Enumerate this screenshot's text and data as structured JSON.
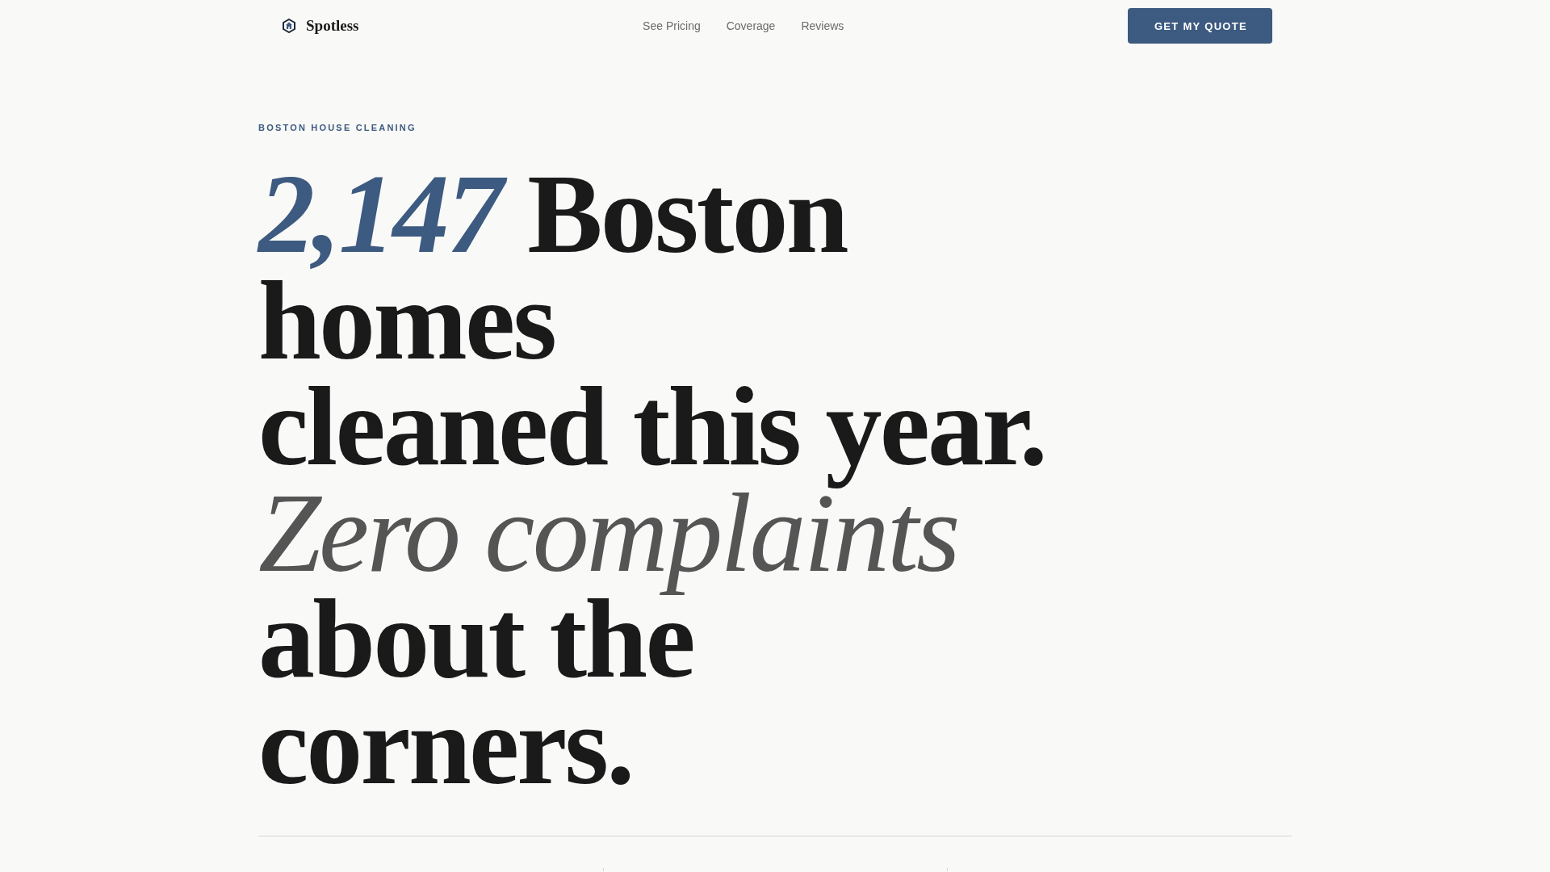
{
  "header": {
    "logo": {
      "name": "Spotless"
    },
    "nav": [
      {
        "label": "See Pricing"
      },
      {
        "label": "Coverage"
      },
      {
        "label": "Reviews"
      }
    ],
    "cta": {
      "label": "GET MY QUOTE"
    }
  },
  "hero": {
    "eyebrow": "BOSTON HOUSE CLEANING",
    "headline": [
      {
        "parts": [
          {
            "kind": "stat",
            "text": "2,147"
          },
          {
            "kind": "plain",
            "text": "Boston homes"
          }
        ]
      },
      {
        "parts": [
          {
            "kind": "plain",
            "text": "cleaned this year."
          }
        ]
      },
      {
        "parts": [
          {
            "kind": "accent",
            "text": "Zero complaints"
          }
        ]
      },
      {
        "parts": [
          {
            "kind": "plain",
            "text": "about the corners."
          }
        ]
      }
    ]
  }
}
